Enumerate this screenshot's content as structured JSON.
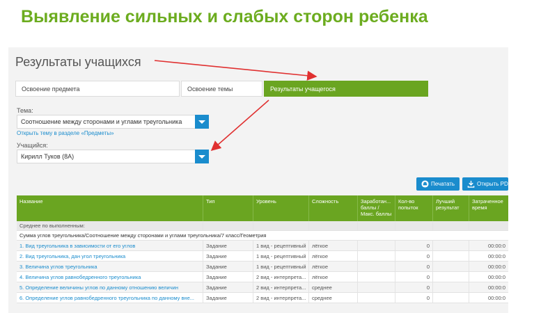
{
  "slide": {
    "title": "Выявление сильных и слабых сторон ребенка"
  },
  "panel": {
    "heading": "Результаты учащихся",
    "tabs": [
      {
        "label": "Освоение предмета",
        "active": false
      },
      {
        "label": "Освоение темы",
        "active": false
      },
      {
        "label": "Результаты учащегося",
        "active": true
      }
    ],
    "topic": {
      "label": "Тема:",
      "value": "Соотношение между сторонами и углами треугольника",
      "link": "Открыть тему в разделе «Предметы»"
    },
    "student": {
      "label": "Учащийся:",
      "value": "Кирилл Туков (8А)"
    },
    "buttons": {
      "print": "Печатать",
      "pdf": "Открыть PDF"
    }
  },
  "table": {
    "headers": [
      "Название",
      "Тип",
      "Уровень",
      "Сложность",
      "Заработан... баллы / Макс. баллы",
      "Кол-во попыток",
      "Лучший результат",
      "Затраченное время"
    ],
    "subheader": "Среднее по выполненным:",
    "group": "Сумма углов треугольника/Соотношение между сторонами и углами треугольника/7 класс/Геометрия",
    "rows": [
      {
        "name": "1. Вид треугольника в зависимости от его углов",
        "type": "Задание",
        "level": "1 вид - рецептивный",
        "difficulty": "лёгкое",
        "attempts": "0",
        "time": "00:00:0"
      },
      {
        "name": "2. Вид треугольника, дан угол треугольника",
        "type": "Задание",
        "level": "1 вид - рецептивный",
        "difficulty": "лёгкое",
        "attempts": "0",
        "time": "00:00:0"
      },
      {
        "name": "3. Величина углов треугольника",
        "type": "Задание",
        "level": "1 вид - рецептивный",
        "difficulty": "лёгкое",
        "attempts": "0",
        "time": "00:00:0"
      },
      {
        "name": "4. Величина углов равнобедренного треугольника",
        "type": "Задание",
        "level": "2 вид - интерпрета...",
        "difficulty": "лёгкое",
        "attempts": "0",
        "time": "00:00:0"
      },
      {
        "name": "5. Определение величины углов по данному отношению величин",
        "type": "Задание",
        "level": "2 вид - интерпрета...",
        "difficulty": "среднее",
        "attempts": "0",
        "time": "00:00:0"
      },
      {
        "name": "6. Определение углов равнобедренного треугольника по данному вне...",
        "type": "Задание",
        "level": "2 вид - интерпрета...",
        "difficulty": "среднее",
        "attempts": "0",
        "time": "00:00:0"
      }
    ]
  },
  "colors": {
    "title_green": "#6cac1f",
    "header_green": "#6aa521",
    "accent_blue": "#1a8ccd",
    "arrow_red": "#e03030"
  },
  "icons": {
    "print": "printer-icon",
    "pdf": "download-icon",
    "dropdown": "triangle-down-icon"
  }
}
